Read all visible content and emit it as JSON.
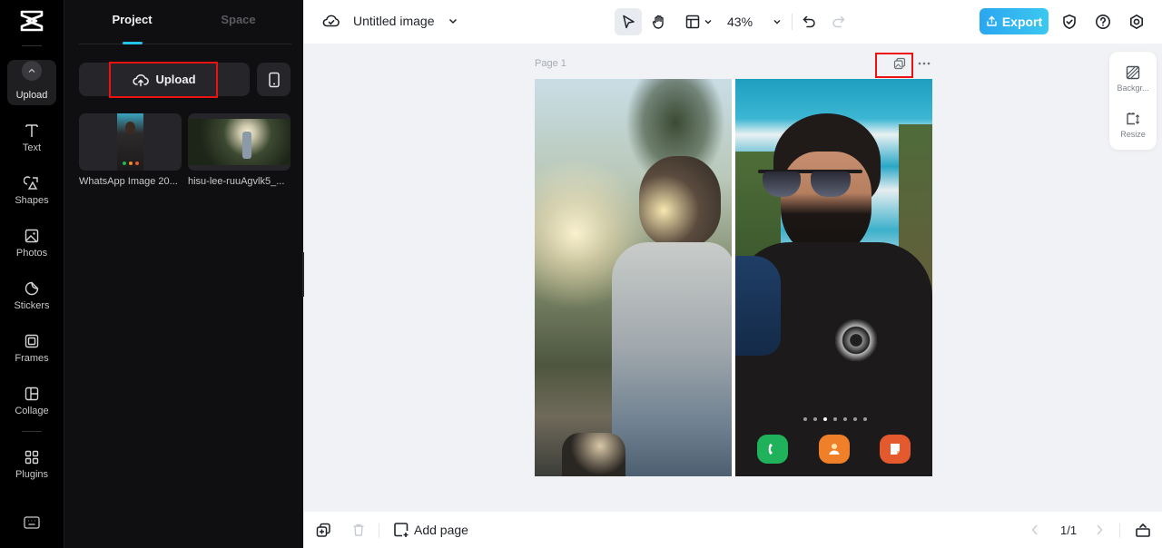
{
  "rail": {
    "logo": "capcut-logo-icon",
    "items": [
      {
        "label": "Upload",
        "icon": "upload-icon",
        "active": true
      },
      {
        "label": "Text",
        "icon": "text-icon"
      },
      {
        "label": "Shapes",
        "icon": "shapes-icon"
      },
      {
        "label": "Photos",
        "icon": "photos-icon"
      },
      {
        "label": "Stickers",
        "icon": "stickers-icon"
      },
      {
        "label": "Frames",
        "icon": "frames-icon"
      },
      {
        "label": "Collage",
        "icon": "collage-icon"
      },
      {
        "label": "Plugins",
        "icon": "plugins-icon"
      }
    ],
    "bottom_icon": "keyboard-icon"
  },
  "panel": {
    "tabs": [
      {
        "label": "Project",
        "active": true
      },
      {
        "label": "Space",
        "active": false
      }
    ],
    "upload_label": "Upload",
    "assets": [
      {
        "name": "WhatsApp Image 20..."
      },
      {
        "name": "hisu-lee-ruuAgvlk5_..."
      }
    ]
  },
  "topbar": {
    "title": "Untitled image",
    "zoom": "43%",
    "export_label": "Export"
  },
  "canvas": {
    "page_label": "Page 1",
    "side_panel": [
      {
        "label": "Backgr...",
        "icon": "background-icon"
      },
      {
        "label": "Resize",
        "icon": "resize-icon"
      }
    ]
  },
  "bottombar": {
    "add_page_label": "Add page",
    "pager": "1/1"
  },
  "colors": {
    "accent": "#22c3e6",
    "export_start": "#2aa6f0",
    "export_end": "#3cc8f0",
    "highlight": "#ee1111",
    "rail_bg": "#000000",
    "panel_bg": "#0f0f11",
    "canvas_bg": "#f0f2f5"
  }
}
